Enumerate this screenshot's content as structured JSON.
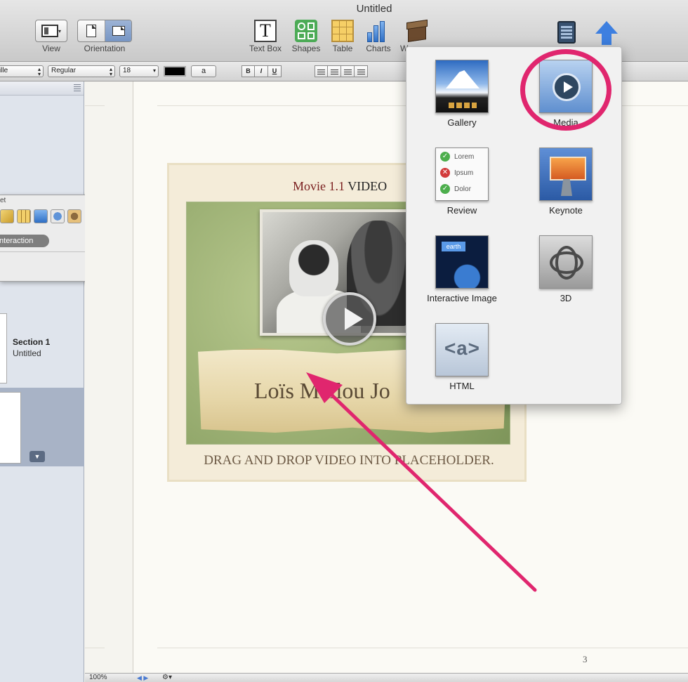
{
  "window": {
    "title": "Untitled"
  },
  "toolbar": {
    "view_label": "View",
    "orientation_label": "Orientation",
    "textbox_label": "Text Box",
    "textbox_glyph": "T",
    "shapes_label": "Shapes",
    "table_label": "Table",
    "charts_label": "Charts",
    "widgets_label_partial": "W"
  },
  "format_bar": {
    "font_family": "ille",
    "font_style": "Regular",
    "font_size": "18",
    "text_sample": "a",
    "bold": "B",
    "italic": "I",
    "underline": "U"
  },
  "inspector": {
    "title_partial": "et",
    "tab_label": "Interaction"
  },
  "sidebar": {
    "section_title": "Section 1",
    "section_subtitle": "Untitled",
    "chapter_toggle": "▼"
  },
  "page": {
    "widget_label_number": "Movie 1.1",
    "widget_label_text": "VIDEO",
    "parchment_text": "Loïs Mailou Jo",
    "caption": "DRAG AND DROP VIDEO INTO PLACEHOLDER.",
    "page_number": "3"
  },
  "widget_popover": {
    "items": [
      {
        "label": "Gallery"
      },
      {
        "label": "Media"
      },
      {
        "label": "Review"
      },
      {
        "label": "Keynote"
      },
      {
        "label": "Interactive Image"
      },
      {
        "label": "3D"
      },
      {
        "label": "HTML"
      }
    ],
    "review_rows": [
      "Lorem",
      "Ipsum",
      "Dolor"
    ],
    "interactive_tag": "earth",
    "html_glyph": "<a>"
  },
  "statusbar": {
    "zoom": "100%"
  },
  "colors": {
    "annotation_pink": "#e0266e",
    "accent_blue": "#3d7fe0"
  }
}
